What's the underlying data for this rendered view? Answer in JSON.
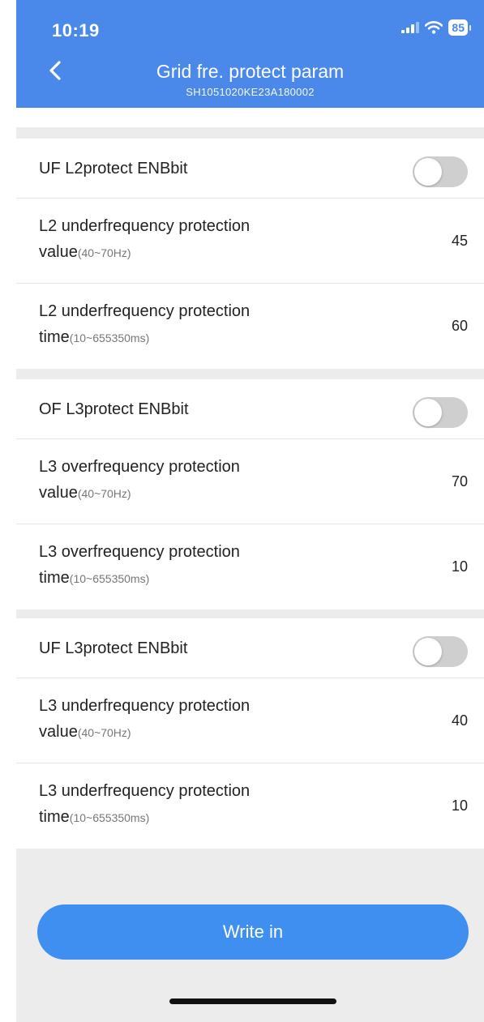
{
  "status_bar": {
    "time": "10:19",
    "battery": "85"
  },
  "header": {
    "title": "Grid fre. protect param",
    "serial": "SH1051020KE23A180002"
  },
  "sections": [
    {
      "toggle": {
        "label": "UF L2protect ENBbit",
        "enabled": false
      },
      "rows": [
        {
          "label_line1": "L2 underfrequency protection",
          "label_line2": "value",
          "range": "(40~70Hz)",
          "value": "45"
        },
        {
          "label_line1": "L2 underfrequency protection",
          "label_line2": "time",
          "range": "(10~655350ms)",
          "value": "60"
        }
      ]
    },
    {
      "toggle": {
        "label": "OF L3protect ENBbit",
        "enabled": false
      },
      "rows": [
        {
          "label_line1": "L3 overfrequency protection",
          "label_line2": "value",
          "range": "(40~70Hz)",
          "value": "70"
        },
        {
          "label_line1": "L3 overfrequency protection",
          "label_line2": "time",
          "range": "(10~655350ms)",
          "value": "10"
        }
      ]
    },
    {
      "toggle": {
        "label": "UF L3protect ENBbit",
        "enabled": false
      },
      "rows": [
        {
          "label_line1": "L3 underfrequency protection",
          "label_line2": "value",
          "range": "(40~70Hz)",
          "value": "40"
        },
        {
          "label_line1": "L3 underfrequency protection",
          "label_line2": "time",
          "range": "(10~655350ms)",
          "value": "10"
        }
      ]
    }
  ],
  "footer": {
    "write_label": "Write in"
  },
  "colors": {
    "header": "#4a89ea",
    "button": "#3f8ff0",
    "background": "#ececec",
    "toggle_off": "#cfcfcf"
  }
}
